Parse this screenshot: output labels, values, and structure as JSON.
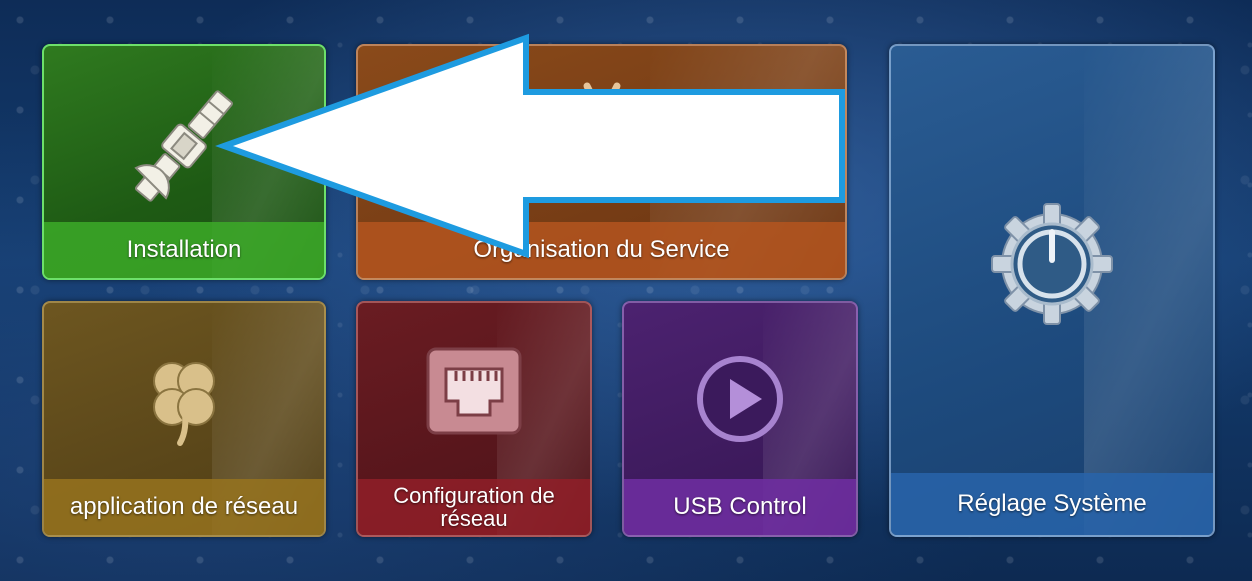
{
  "tiles": {
    "installation": {
      "label": "Installation",
      "icon": "satellite-icon"
    },
    "service": {
      "label": "Organisation du Service",
      "icon": "service-organisation-icon"
    },
    "app": {
      "label": "application de réseau",
      "icon": "clover-icon"
    },
    "config": {
      "label": "Configuration de\nréseau",
      "icon": "ethernet-port-icon"
    },
    "usb": {
      "label": "USB Control",
      "icon": "play-icon"
    },
    "system": {
      "label": "Réglage Système",
      "icon": "power-gear-icon"
    }
  },
  "annotation": {
    "icon": "pointer-arrow-icon",
    "color": "#1e9be0"
  },
  "colors": {
    "installation_bar": "#3caa28",
    "service_bar": "#b4551e",
    "app_bar": "#96731e",
    "config_bar": "#911e28",
    "usb_bar": "#6e2da0",
    "system_bar": "#2864aa"
  }
}
